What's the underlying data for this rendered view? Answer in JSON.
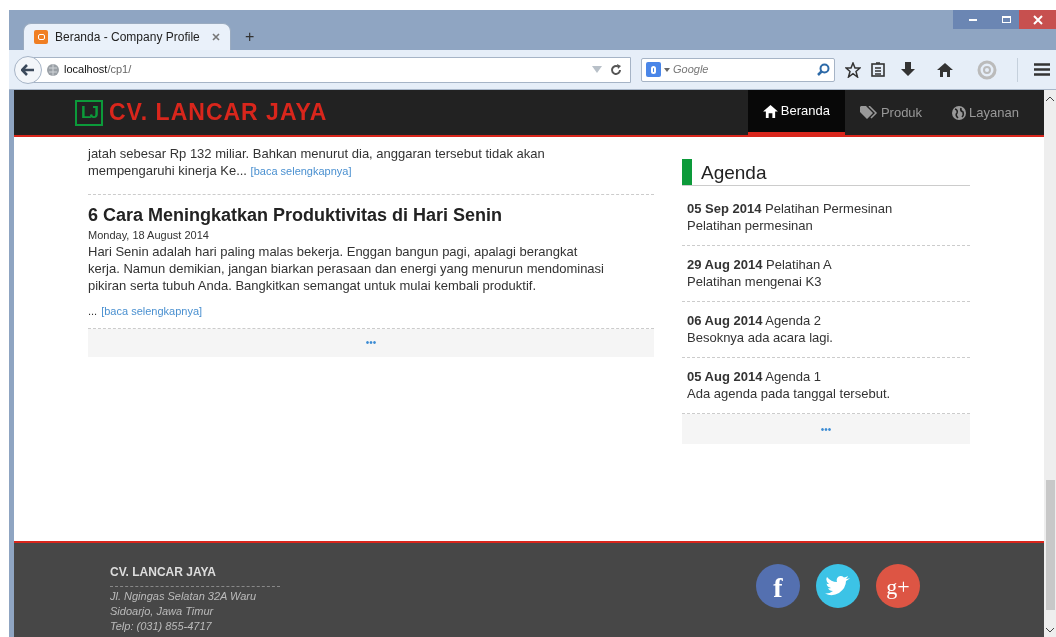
{
  "browser": {
    "tabs": [
      {
        "title": "Beranda - Company Profile",
        "selected": true
      }
    ],
    "new_tab": "+",
    "address": {
      "host": "localhost",
      "path": "/cp1/"
    },
    "search": {
      "placeholder": "Google"
    }
  },
  "site": {
    "brand": "CV. LANCAR JAYA",
    "brand_mark": "LJ",
    "nav": [
      {
        "label": "Beranda",
        "kind": "home",
        "selected": true
      },
      {
        "label": "Produk",
        "kind": "tags",
        "selected": false
      },
      {
        "label": "Layanan",
        "kind": "globe",
        "selected": false
      }
    ]
  },
  "articles": [
    {
      "excerpt": [
        "jatah sebesar Rp 132 miliar. Bahkan menurut dia, anggaran tersebut tidak akan",
        "mempengaruhi kinerja Ke..."
      ],
      "link": "[baca selengkapnya]"
    },
    {
      "title": "6 Cara Meningkatkan Produktivitas di Hari Senin",
      "date": "Monday, 18 August 2014",
      "excerpt": [
        "Hari Senin adalah hari paling malas bekerja. Enggan bangun pagi, apalagi berangkat",
        "kerja. Namun demikian, jangan biarkan perasaan dan energi yang menurun mendominasi",
        "pikiran serta tubuh Anda. Bangkitkan semangat untuk mulai kembali produktif."
      ],
      "ellipsis": "...",
      "link": "[baca selengkapnya]"
    }
  ],
  "articles_more": "•••",
  "agenda": {
    "title": "Agenda",
    "items": [
      {
        "date": "05 Sep 2014",
        "title": "Pelatihan Permesinan",
        "description": "Pelatihan permesinan"
      },
      {
        "date": "29 Aug 2014",
        "title": "Pelatihan A",
        "description": "Pelatihan mengenai K3"
      },
      {
        "date": "06 Aug 2014",
        "title": "Agenda 2",
        "description": "Besoknya ada acara lagi."
      },
      {
        "date": "05 Aug 2014",
        "title": "Agenda 1",
        "description": "Ada agenda pada tanggal tersebut."
      }
    ],
    "more": "•••"
  },
  "footer": {
    "company": "CV. LANCAR JAYA",
    "address": [
      "Jl. Ngingas Selatan 32A Waru",
      "Sidoarjo, Jawa Timur",
      "Telp: (031) 855-4717"
    ],
    "social": [
      {
        "kind": "facebook",
        "glyph": "f",
        "color": "#5470b0"
      },
      {
        "kind": "twitter",
        "color": "#3cc3e6"
      },
      {
        "kind": "googleplus",
        "glyph": "g+",
        "color": "#dd5544"
      }
    ]
  }
}
